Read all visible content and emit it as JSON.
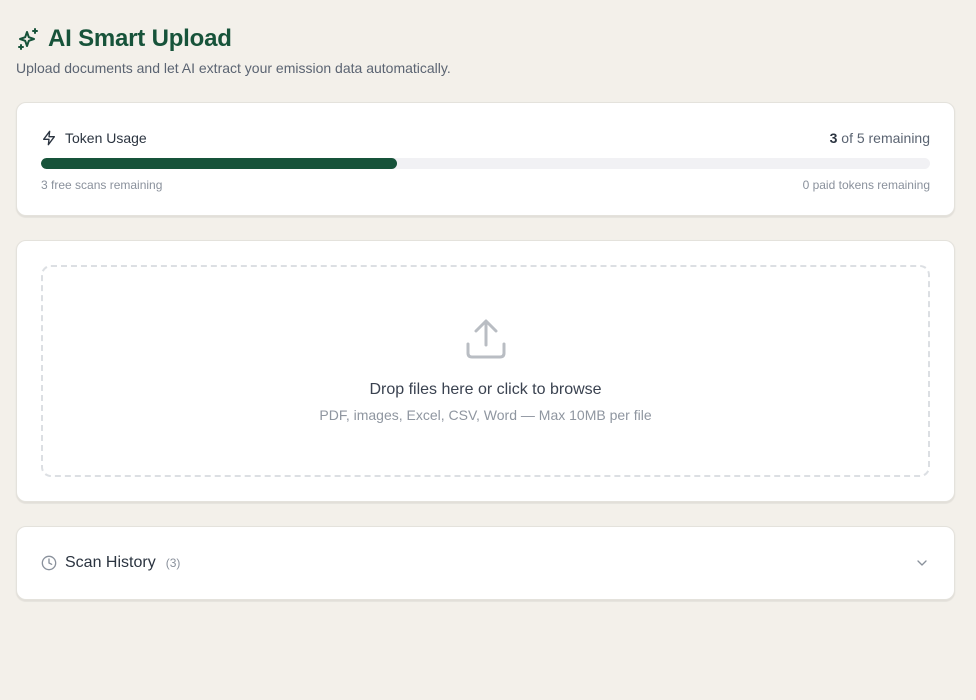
{
  "header": {
    "title": "AI Smart Upload",
    "subtitle": "Upload documents and let AI extract your emission data automatically."
  },
  "token_usage": {
    "label": "Token Usage",
    "remaining_count": "3",
    "remaining_suffix": "of 5 remaining",
    "used_fraction": 0.4,
    "free_scans_text": "3 free scans remaining",
    "paid_tokens_text": "0 paid tokens remaining"
  },
  "upload": {
    "title": "Drop files here or click to browse",
    "hint": "PDF, images, Excel, CSV, Word — Max 10MB per file"
  },
  "history": {
    "title": "Scan History",
    "count": "(3)"
  },
  "colors": {
    "brand": "#17533a",
    "background": "#f3f0ea",
    "card": "#ffffff"
  },
  "icons": {
    "title": "sparkles-icon",
    "token": "lightning-icon",
    "upload": "upload-icon",
    "history": "clock-icon",
    "toggle": "chevron-down-icon"
  }
}
